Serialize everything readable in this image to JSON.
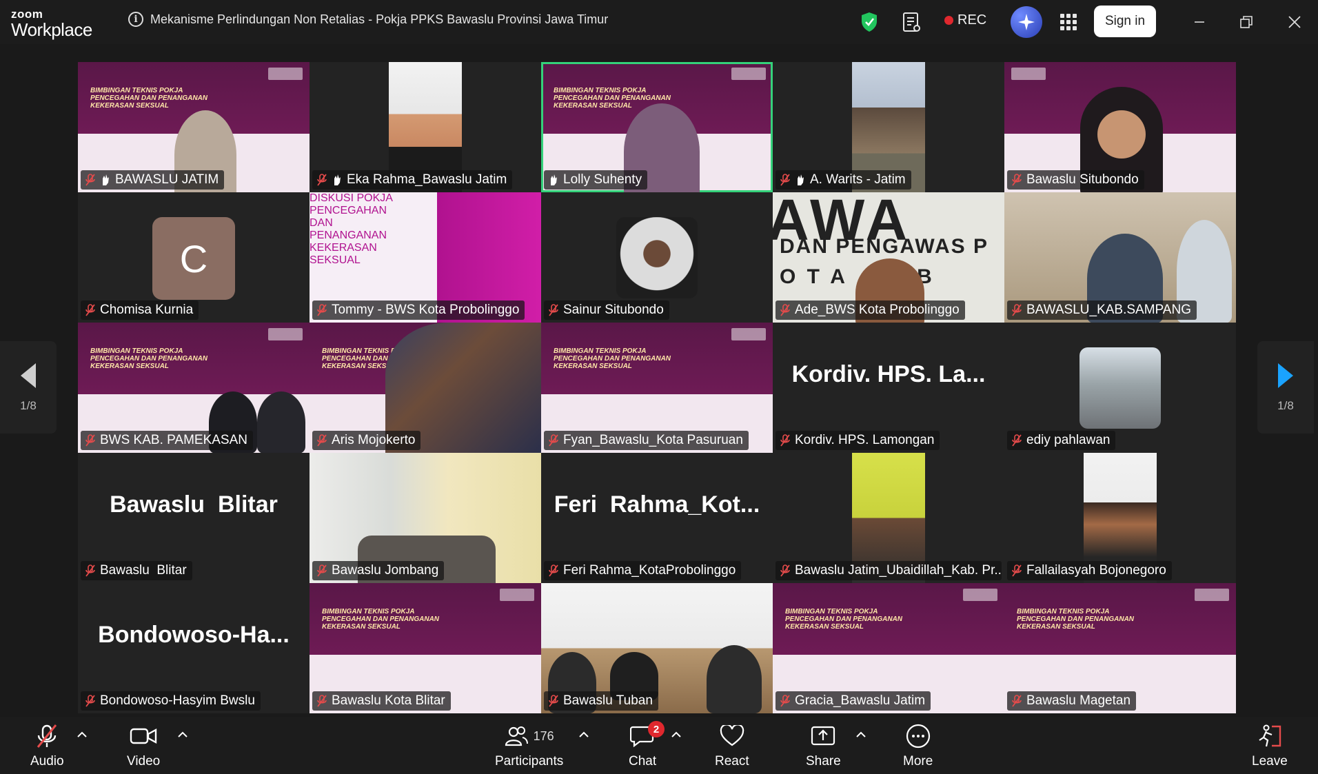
{
  "app": {
    "logo_top": "zoom",
    "logo_bottom": "Workplace",
    "meeting_title": "Mekanisme Perlindungan Non Retalias - Pokja PPKS Bawaslu Provinsi Jawa Timur",
    "rec_label": "REC",
    "signin_label": "Sign in"
  },
  "gallery": {
    "page_left": "1/8",
    "page_right": "1/8",
    "tiles": [
      {
        "name": "BAWASLU JATIM"
      },
      {
        "name": "Eka Rahma_Bawaslu Jatim"
      },
      {
        "name": "Lolly Suhenty"
      },
      {
        "name": "A. Warits - Jatim"
      },
      {
        "name": "Bawaslu Situbondo"
      },
      {
        "name": "Chomisa Kurnia",
        "avatar_letter": "C"
      },
      {
        "name": "Tommy - BWS Kota Probolinggo"
      },
      {
        "name": "Sainur Situbondo"
      },
      {
        "name": "Ade_BWS Kota Probolinggo"
      },
      {
        "name": "BAWASLU_KAB.SAMPANG"
      },
      {
        "name": "BWS KAB. PAMEKASAN"
      },
      {
        "name": "Aris Mojokerto"
      },
      {
        "name": "Fyan_Bawaslu_Kota Pasuruan"
      },
      {
        "name": "Kordiv. HPS. Lamongan",
        "display": "Kordiv. HPS. La..."
      },
      {
        "name": "ediy pahlawan"
      },
      {
        "name": "Bawaslu  Blitar",
        "display": "Bawaslu  Blitar"
      },
      {
        "name": "Bawaslu Jombang"
      },
      {
        "name": "Feri Rahma_KotaProbolinggo",
        "display": "Feri  Rahma_Kot..."
      },
      {
        "name": "Bawaslu Jatim_Ubaidillah_Kab. Pr..."
      },
      {
        "name": "Fallailasyah Bojonegoro"
      },
      {
        "name": "Bondowoso-Hasyim Bwslu",
        "display": "Bondowoso-Ha..."
      },
      {
        "name": "Bawaslu Kota Blitar"
      },
      {
        "name": "Bawaslu Tuban"
      },
      {
        "name": "Gracia_Bawaslu Jatim"
      },
      {
        "name": "Bawaslu Magetan"
      }
    ],
    "slide_text": "BIMBINGAN TEKNIS POKJA PENCEGAHAN DAN PENANGANAN KEKERASAN SEKSUAL",
    "slide_text_diskusi": "DISKUSI POKJA PENCEGAHAN DAN PENANGANAN KEKERASAN SEKSUAL",
    "bg_text_line1": "AWA",
    "bg_text_line2": "DAN PENGAWAS P",
    "bg_text_line3": "O T A     O B"
  },
  "toolbar": {
    "audio": "Audio",
    "video": "Video",
    "participants": "Participants",
    "participants_count": "176",
    "chat": "Chat",
    "chat_badge": "2",
    "react": "React",
    "share": "Share",
    "more": "More",
    "leave": "Leave"
  },
  "colors": {
    "active_speaker": "#34d17a",
    "rec": "#e0282e",
    "nav_arrow": "#1aa3ff",
    "shield": "#22c55e",
    "slide_purple": "#6e1b55"
  }
}
